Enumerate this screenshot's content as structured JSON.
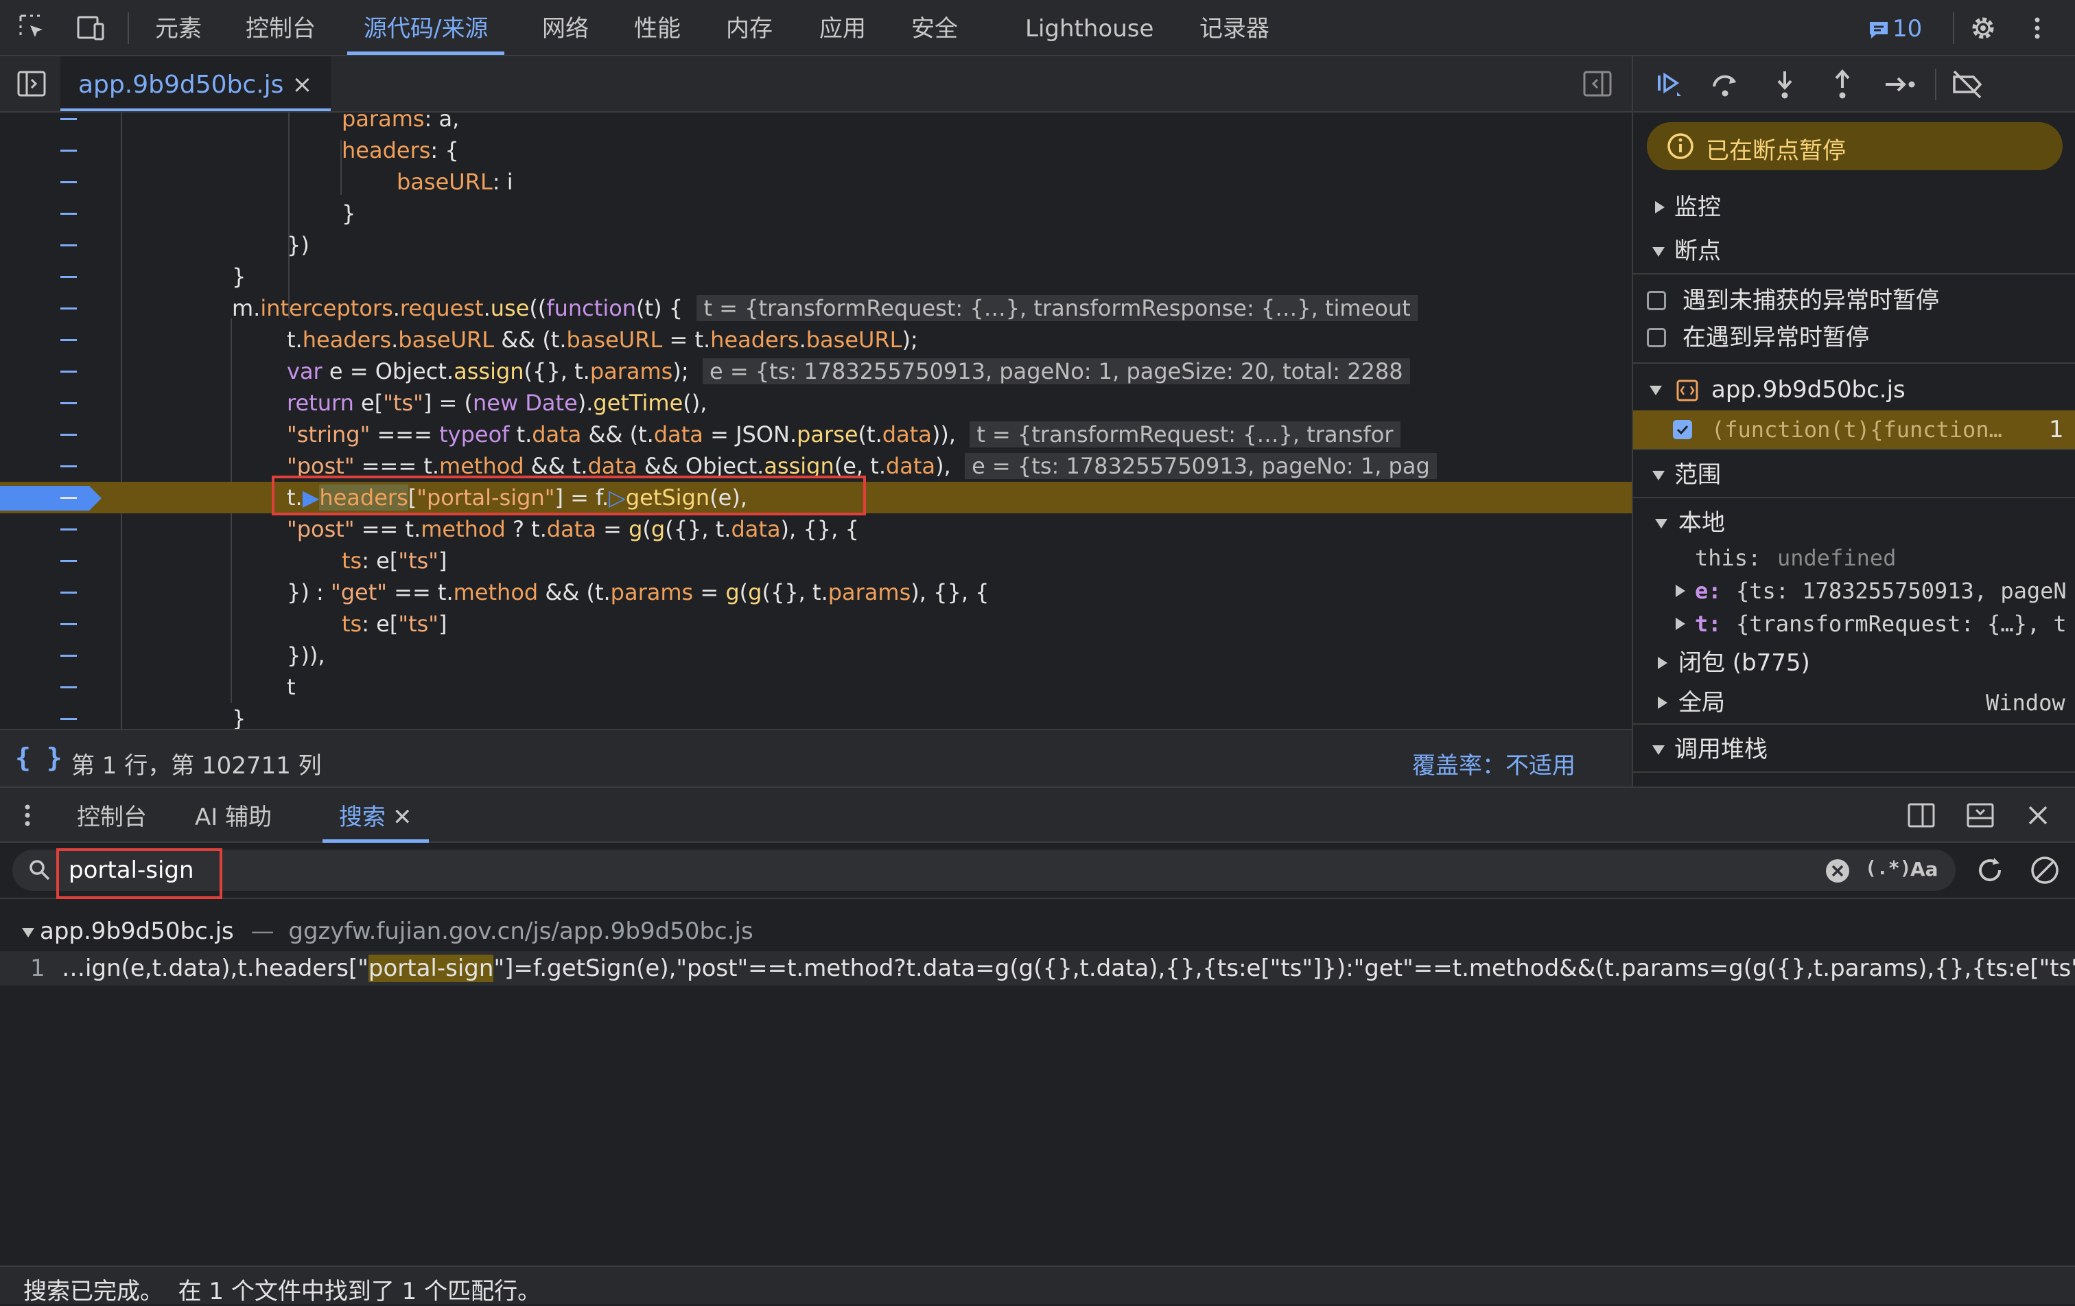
{
  "top_tabs": [
    "元素",
    "控制台",
    "源代码/来源",
    "网络",
    "性能",
    "内存",
    "应用",
    "安全",
    "Lighthouse",
    "记录器"
  ],
  "issues_count": "10",
  "editor": {
    "file_tab": "app.9b9d50bc.js",
    "close": "×",
    "lines": [
      "params: a,",
      "headers: {",
      "baseURL: i",
      "}",
      "})",
      "}",
      "m.interceptors.request.use((function(t) {",
      "t.headers.baseURL && (t.baseURL = t.headers.baseURL);",
      "var e = Object.assign({}, t.params);",
      "return e[\"ts\"] = (new Date).getTime(),",
      "\"string\" === typeof t.data && (t.data = JSON.parse(t.data)),",
      "\"post\" === t.method && t.data && Object.assign(e, t.data),",
      "t.headers[\"portal-sign\"] = f.getSign(e),",
      "\"post\" == t.method ? t.data = g(g({}, t.data), {}, {",
      "ts: e[\"ts\"]",
      "}) : \"get\" == t.method && (t.params = g(g({}, t.params), {}, {",
      "ts: e[\"ts\"]",
      "})),",
      "t",
      "}"
    ],
    "inline_values": {
      "line7": "t = {transformRequest: {…}, transformResponse: {…}, timeout",
      "line9": "e = {ts: 1783255750913, pageNo: 1, pageSize: 20, total: 2288",
      "line11": "t = {transformRequest: {…}, transfor",
      "line12": "e = {ts: 1783255750913, pageNo: 1, pag"
    },
    "status_position": "第 1 行，第 102711 列",
    "status_braces": "{ }",
    "coverage": "覆盖率：不适用"
  },
  "debugger": {
    "paused_label": "已在断点暂停",
    "watch": "监控",
    "breakpoints": "断点",
    "pause_uncaught": "遇到未捕获的异常时暂停",
    "pause_caught": "在遇到异常时暂停",
    "bp_file": "app.9b9d50bc.js",
    "bp_entry": "(function(t){function…",
    "bp_line": "1",
    "scope": "范围",
    "local": "本地",
    "this_key": "this:",
    "this_val": "undefined",
    "e_key": "e:",
    "e_val": "{ts: 1783255750913, pageN",
    "t_key": "t:",
    "t_val": "{transformRequest: {…}, t",
    "closure": "闭包 (b775)",
    "global": "全局",
    "global_val": "Window",
    "call_stack": "调用堆栈"
  },
  "drawer": {
    "tabs": [
      "控制台",
      "AI 辅助",
      "搜索"
    ],
    "search_value": "portal-sign",
    "regex_label": "(.*)",
    "case_label": "Aa",
    "result_file": "app.9b9d50bc.js",
    "result_dash": "—",
    "result_url": "ggzyfw.fujian.gov.cn/js/app.9b9d50bc.js",
    "match_line_no": "1",
    "match_before": "…ign(e,t.data),t.headers[\"",
    "match_term": "portal-sign",
    "match_after": "\"]=f.getSign(e),\"post\"==t.method?t.data=g(g({},t.data),{},{ts:e[\"ts\"]}):\"get\"==t.method&&(t.params=g(g({},t.params),{},{ts:e[\"ts\"]})),t}…",
    "footer": "搜索已完成。  在 1 个文件中找到了 1 个匹配行。"
  }
}
